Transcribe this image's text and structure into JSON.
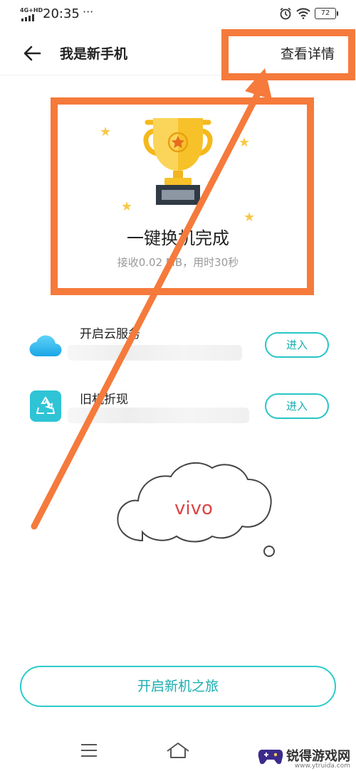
{
  "status_bar": {
    "network": "4G+HD",
    "time": "20:35",
    "dots": "···",
    "battery": "72"
  },
  "header": {
    "back_icon": "arrow-left-icon",
    "title": "我是新手机",
    "details_link": "查看详情"
  },
  "hero": {
    "icon": "trophy-icon",
    "title": "一键换机完成",
    "subtitle": "接收0.02 MB，用时30秒"
  },
  "features": [
    {
      "title": "开启云服务",
      "icon": "cloud-icon",
      "button": "进入"
    },
    {
      "title": "旧机折现",
      "icon": "recycle-icon",
      "button": "进入"
    }
  ],
  "illustration": {
    "text": "vivo"
  },
  "primary_button": "开启新机之旅",
  "navbar": {
    "menu_icon": "menu-icon",
    "home_icon": "home-icon"
  },
  "watermark": {
    "text": "锐得游戏网",
    "url": "www.ytruida.com"
  },
  "colors": {
    "accent": "#27c5c5",
    "annotation": "#f57a3c",
    "star": "#f7c948"
  }
}
